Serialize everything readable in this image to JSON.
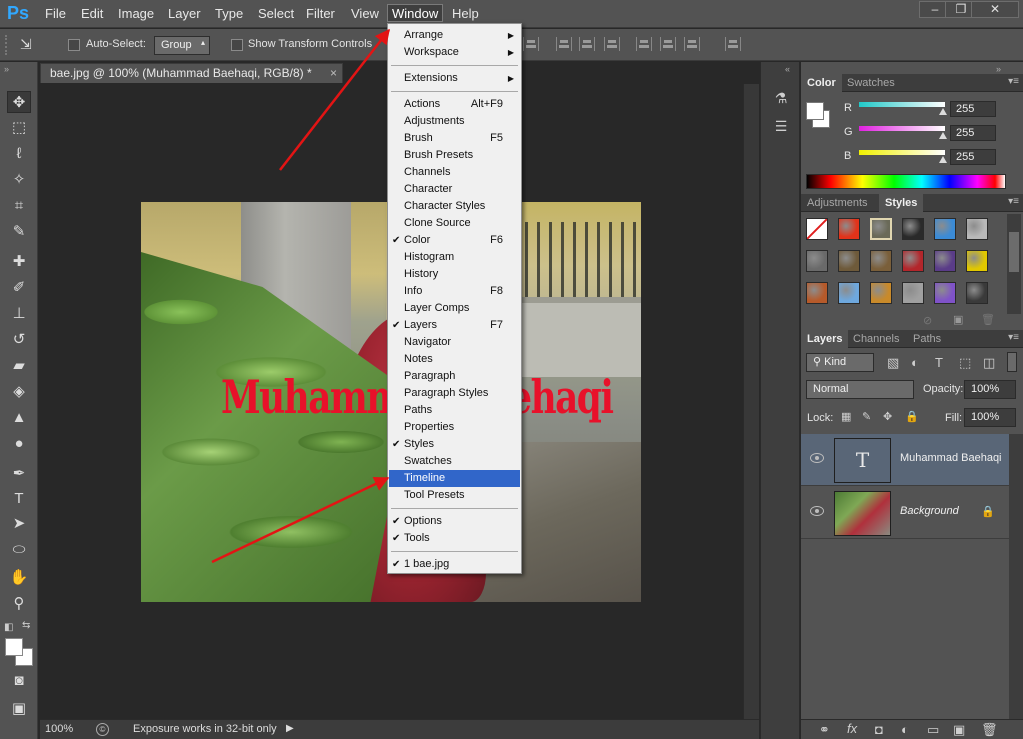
{
  "app": {
    "logo": "Ps"
  },
  "menubar": {
    "items": [
      "File",
      "Edit",
      "Image",
      "Layer",
      "Type",
      "Select",
      "Filter",
      "View",
      "Window",
      "Help"
    ],
    "active": "Window",
    "window_controls": {
      "minimize": "–",
      "restore": "❐",
      "close": "✕"
    }
  },
  "options_bar": {
    "auto_select_label": "Auto-Select:",
    "auto_select_value": "Group",
    "show_transform_label": "Show Transform Controls"
  },
  "document": {
    "tab_title": "bae.jpg @ 100% (Muhammad Baehaqi, RGB/8) *",
    "close_glyph": "×",
    "overlay_text": "Muhammad Baehaqi",
    "zoom": "100%",
    "status_text": "Exposure works in 32-bit only"
  },
  "window_menu": {
    "groups": [
      [
        {
          "label": "Arrange",
          "submenu": true
        },
        {
          "label": "Workspace",
          "submenu": true
        }
      ],
      [
        {
          "label": "Extensions",
          "submenu": true
        }
      ],
      [
        {
          "label": "Actions",
          "shortcut": "Alt+F9"
        },
        {
          "label": "Adjustments"
        },
        {
          "label": "Brush",
          "shortcut": "F5"
        },
        {
          "label": "Brush Presets"
        },
        {
          "label": "Channels"
        },
        {
          "label": "Character"
        },
        {
          "label": "Character Styles"
        },
        {
          "label": "Clone Source"
        },
        {
          "label": "Color",
          "shortcut": "F6",
          "checked": true
        },
        {
          "label": "Histogram"
        },
        {
          "label": "History"
        },
        {
          "label": "Info",
          "shortcut": "F8"
        },
        {
          "label": "Layer Comps"
        },
        {
          "label": "Layers",
          "shortcut": "F7",
          "checked": true
        },
        {
          "label": "Navigator"
        },
        {
          "label": "Notes"
        },
        {
          "label": "Paragraph"
        },
        {
          "label": "Paragraph Styles"
        },
        {
          "label": "Paths"
        },
        {
          "label": "Properties"
        },
        {
          "label": "Styles",
          "checked": true
        },
        {
          "label": "Swatches"
        },
        {
          "label": "Timeline",
          "highlighted": true
        },
        {
          "label": "Tool Presets"
        }
      ],
      [
        {
          "label": "Options",
          "checked": true
        },
        {
          "label": "Tools",
          "checked": true
        }
      ],
      [
        {
          "label": "1 bae.jpg",
          "checked": true
        }
      ]
    ]
  },
  "color_panel": {
    "tabs": [
      "Color",
      "Swatches"
    ],
    "active_tab": "Color",
    "channels": [
      {
        "label": "R",
        "value": "255",
        "gradient": [
          "#20c8c8",
          "#ffffff"
        ]
      },
      {
        "label": "G",
        "value": "255",
        "gradient": [
          "#e020e0",
          "#ffffff"
        ]
      },
      {
        "label": "B",
        "value": "255",
        "gradient": [
          "#f0f000",
          "#ffffff"
        ]
      }
    ]
  },
  "styles_panel": {
    "tabs": [
      "Adjustments",
      "Styles"
    ],
    "active_tab": "Styles",
    "swatches": [
      "#ffffff",
      "#e2331a",
      "#6a6a58",
      "#2a2a2a",
      "#3b8bd6",
      "#b9b9b9",
      "#6a6a6a",
      "#6e5a3a",
      "#7a5f3a",
      "#b3262b",
      "#5a3c88",
      "#e1c800",
      "#b65a2a",
      "#6ea8de",
      "#c98a2a",
      "#a0a0a0",
      "#7f52c8",
      "#3a3a3a"
    ]
  },
  "layers_panel": {
    "tabs": [
      "Layers",
      "Channels",
      "Paths"
    ],
    "active_tab": "Layers",
    "filter_kind": "Kind",
    "blend_mode": "Normal",
    "opacity_label": "Opacity:",
    "opacity_value": "100%",
    "lock_label": "Lock:",
    "fill_label": "Fill:",
    "fill_value": "100%",
    "layers": [
      {
        "name": "Muhammad Baehaqi",
        "type": "text",
        "thumb_glyph": "T",
        "selected": true
      },
      {
        "name": "Background",
        "type": "image",
        "locked": true
      }
    ]
  }
}
